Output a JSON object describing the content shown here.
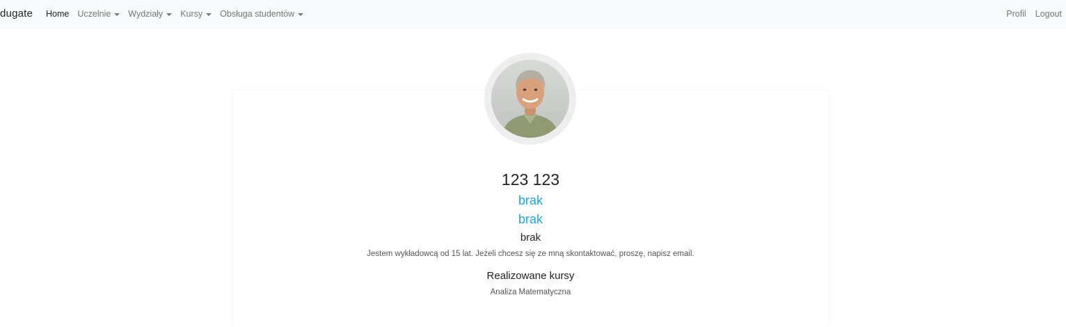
{
  "navbar": {
    "brand": "dugate",
    "items": [
      {
        "label": "Home",
        "active": true,
        "dropdown": false
      },
      {
        "label": "Uczelnie",
        "active": false,
        "dropdown": true
      },
      {
        "label": "Wydziały",
        "active": false,
        "dropdown": true
      },
      {
        "label": "Kursy",
        "active": false,
        "dropdown": true
      },
      {
        "label": "Obsługa studentów",
        "active": false,
        "dropdown": true
      }
    ],
    "right_items": [
      {
        "label": "Profil"
      },
      {
        "label": "Logout"
      }
    ]
  },
  "profile": {
    "name": "123 123",
    "link1": "brak",
    "link2": "brak",
    "subtitle": "brak",
    "bio": "Jestem wykładowcą od 15 lat. Jeżeli chcesz się ze mną skontaktować, proszę, napisz email.",
    "courses_title": "Realizowane kursy",
    "courses": [
      "Analiza Matematyczna"
    ]
  },
  "colors": {
    "navbar_bg": "#f8f9fa",
    "link": "#1fa3e0",
    "text": "#222222"
  }
}
